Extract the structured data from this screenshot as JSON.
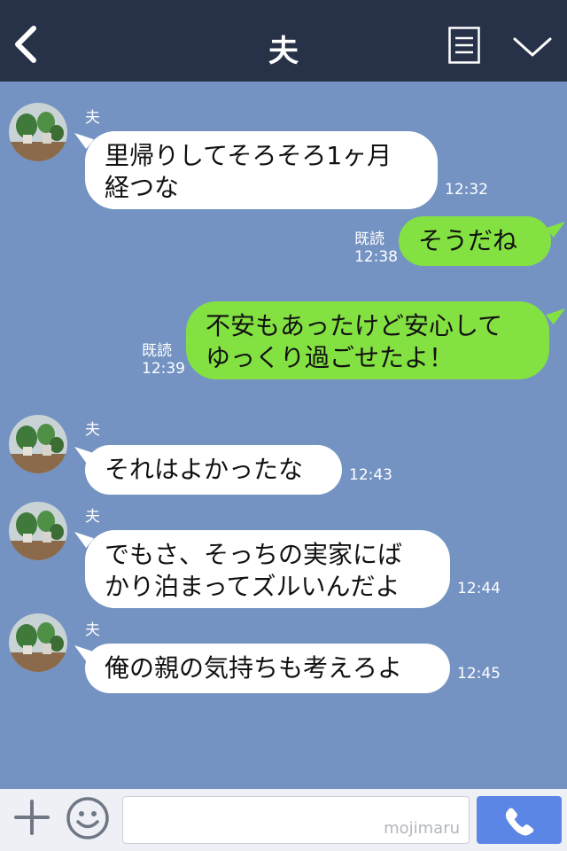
{
  "header": {
    "title": "夫",
    "back_icon": "chevron-left-icon",
    "menu_icon": "list-icon",
    "collapse_icon": "chevron-down-icon"
  },
  "messages": [
    {
      "sender": "夫",
      "text": "里帰りしてそろそろ1ヶ月\n経つな",
      "time": "12:32"
    },
    {
      "read": "既読",
      "text": "そうだね",
      "time": "12:38"
    },
    {
      "read": "既読",
      "text": "不安もあったけど安心して\nゆっくり過ごせたよ！",
      "time": "12:39"
    },
    {
      "sender": "夫",
      "text": "それはよかったな",
      "time": "12:43"
    },
    {
      "sender": "夫",
      "text": "でもさ、そっちの実家にば\nかり泊まってズルいんだよ",
      "time": "12:44"
    },
    {
      "sender": "夫",
      "text": "俺の親の気持ちも考えろよ",
      "time": "12:45"
    }
  ],
  "footer": {
    "plus_icon": "plus-icon",
    "emoji_icon": "smiley-icon",
    "input_value": "",
    "watermark": "mojimaru",
    "call_icon": "phone-icon"
  },
  "colors": {
    "header_bg": "#273248",
    "chat_bg": "#7493c2",
    "outgoing_bubble": "#84e142",
    "incoming_bubble": "#ffffff",
    "call_button": "#5b86e5"
  }
}
